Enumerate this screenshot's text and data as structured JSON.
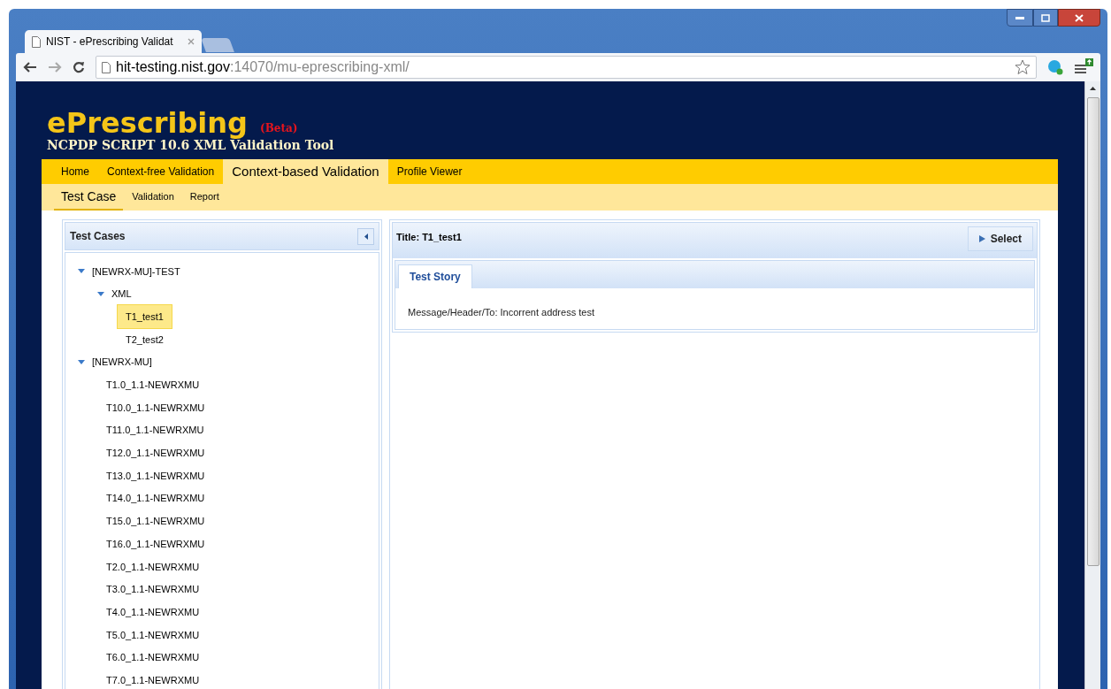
{
  "browser": {
    "tab_title": "NIST - ePrescribing Validat",
    "address_host": "hit-testing.nist.gov",
    "address_path": ":14070/mu-eprescribing-xml/"
  },
  "header": {
    "title": "ePrescribing",
    "badge": "(Beta)",
    "subtitle": "NCPDP SCRIPT 10.6 XML Validation Tool"
  },
  "nav": [
    {
      "label": "Home",
      "selected": false
    },
    {
      "label": "Context-free Validation",
      "selected": false
    },
    {
      "label": "Context-based Validation",
      "selected": true
    },
    {
      "label": "Profile Viewer",
      "selected": false
    }
  ],
  "subnav": [
    {
      "label": "Test Case",
      "selected": true
    },
    {
      "label": "Validation",
      "selected": false
    },
    {
      "label": "Report",
      "selected": false
    }
  ],
  "test_cases": {
    "title": "Test Cases",
    "tree": [
      {
        "label": "[NEWRX-MU]-TEST",
        "expanded": true,
        "selected": false,
        "children": [
          {
            "label": "XML",
            "expanded": true,
            "selected": false,
            "children": [
              {
                "label": "T1_test1",
                "selected": true
              },
              {
                "label": "T2_test2",
                "selected": false
              }
            ]
          }
        ]
      },
      {
        "label": "[NEWRX-MU]",
        "expanded": true,
        "selected": false,
        "children": [
          {
            "label": "T1.0_1.1-NEWRXMU",
            "selected": false
          },
          {
            "label": "T10.0_1.1-NEWRXMU",
            "selected": false
          },
          {
            "label": "T11.0_1.1-NEWRXMU",
            "selected": false
          },
          {
            "label": "T12.0_1.1-NEWRXMU",
            "selected": false
          },
          {
            "label": "T13.0_1.1-NEWRXMU",
            "selected": false
          },
          {
            "label": "T14.0_1.1-NEWRXMU",
            "selected": false
          },
          {
            "label": "T15.0_1.1-NEWRXMU",
            "selected": false
          },
          {
            "label": "T16.0_1.1-NEWRXMU",
            "selected": false
          },
          {
            "label": "T2.0_1.1-NEWRXMU",
            "selected": false
          },
          {
            "label": "T3.0_1.1-NEWRXMU",
            "selected": false
          },
          {
            "label": "T4.0_1.1-NEWRXMU",
            "selected": false
          },
          {
            "label": "T5.0_1.1-NEWRXMU",
            "selected": false
          },
          {
            "label": "T6.0_1.1-NEWRXMU",
            "selected": false
          },
          {
            "label": "T7.0_1.1-NEWRXMU",
            "selected": false
          }
        ]
      }
    ]
  },
  "detail": {
    "title": "Title: T1_test1",
    "select_button": "Select",
    "tabs": [
      {
        "label": "Test Story",
        "selected": true
      }
    ],
    "story": "Message/Header/To: Incorrent address test"
  }
}
